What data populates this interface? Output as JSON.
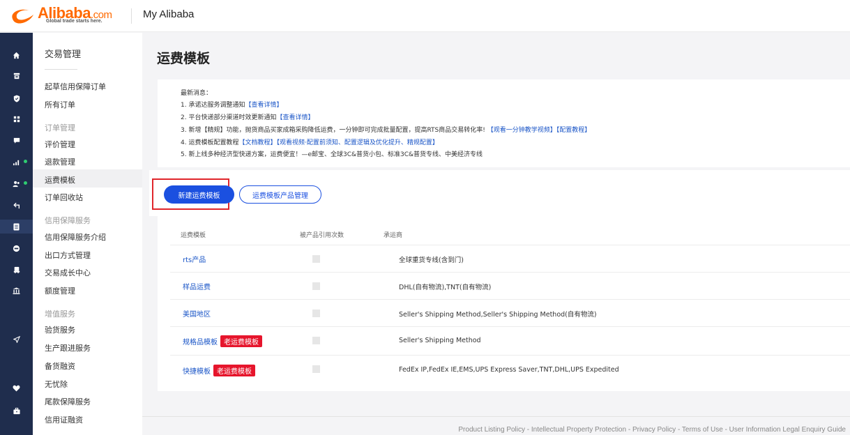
{
  "header": {
    "brand": "Alibaba",
    "brand_suffix": ".com",
    "tagline": "Global trade starts here.",
    "app_title": "My Alibaba"
  },
  "iconbar": [
    {
      "icon": "home-icon"
    },
    {
      "icon": "store-icon"
    },
    {
      "icon": "shield-icon"
    },
    {
      "icon": "apps-icon"
    },
    {
      "icon": "message-icon"
    },
    {
      "icon": "chart-icon"
    },
    {
      "icon": "users-icon"
    },
    {
      "icon": "exchange-icon"
    },
    {
      "icon": "orders-icon"
    },
    {
      "icon": "coin-icon"
    },
    {
      "icon": "truck-icon"
    },
    {
      "icon": "bank-icon"
    },
    {
      "icon": "send-icon"
    },
    {
      "icon": "heart-icon"
    },
    {
      "icon": "briefcase-icon"
    }
  ],
  "sidebar": {
    "heading": "交易管理",
    "items": [
      "起草信用保障订单",
      "所有订单",
      "订单管理",
      "评价管理",
      "退款管理",
      "运费模板",
      "订单回收站",
      "信用保障服务",
      "信用保障服务介绍",
      "出口方式管理",
      "交易成长中心",
      "额度管理",
      "增值服务",
      "验货服务",
      "生产跟进服务",
      "备货融资",
      "无忧除",
      "尾款保障服务",
      "信用证融资"
    ]
  },
  "page": {
    "title": "运费模板"
  },
  "notice": {
    "heading": "最新消息：",
    "line1_text": "1. 承诺达服务调整通知",
    "line1_link": "【查看详情】",
    "line2_text": "2. 平台快递部分渠道时效更新通知",
    "line2_link": "【查看详情】",
    "line3_text": "3. 新增【精规】功能，抛货商品买家成箱采购降低运费，一分钟即可完成批量配置，提高RTS商品交易转化率!",
    "line3_link1": "【观看一分钟教学视频】",
    "line3_link2": "【配置教程】",
    "line4_text": "4. 运费模板配置教程",
    "line4_link1": "【文档教程】",
    "line4_link2": "【观看视频·配置前须知、配置逻辑及优化提升、精规配置】",
    "line5_text": "5. 新上线多种经济型快递方案，运费便宜！—e邮宝、全球3C&普货小包、标准3C&普货专线、中美经济专线"
  },
  "actions": {
    "new_template": "新建运费模板",
    "product_mgmt": "运费模板产品管理"
  },
  "table": {
    "headers": [
      "运费模板",
      "被产品引用次数",
      "承运商"
    ],
    "rows": [
      {
        "name": "rts产品",
        "badge": "",
        "carrier": "全球重货专线(含到门)"
      },
      {
        "name": "样品运费",
        "badge": "",
        "carrier": "DHL(自有物流),TNT(自有物流)"
      },
      {
        "name": "美国地区",
        "badge": "",
        "carrier": "Seller's Shipping Method,Seller's Shipping Method(自有物流)"
      },
      {
        "name": "规格品模板",
        "badge": "老运费模板",
        "carrier": "Seller's Shipping Method"
      },
      {
        "name": "快捷模板",
        "badge": "老运费模板",
        "carrier": "FedEx IP,FedEx IE,EMS,UPS Express Saver,TNT,DHL,UPS Expedited"
      }
    ]
  },
  "footer": {
    "links": "Product Listing Policy - Intellectual Property Protection - Privacy Policy - Terms of Use - User Information Legal Enquiry Guide"
  },
  "colors": {
    "brand": "#ff6a00",
    "primary": "#1b50e0",
    "sidebar_dark": "#1f2d4d",
    "badge_red": "#e6152c",
    "highlight": "#e0252b"
  }
}
